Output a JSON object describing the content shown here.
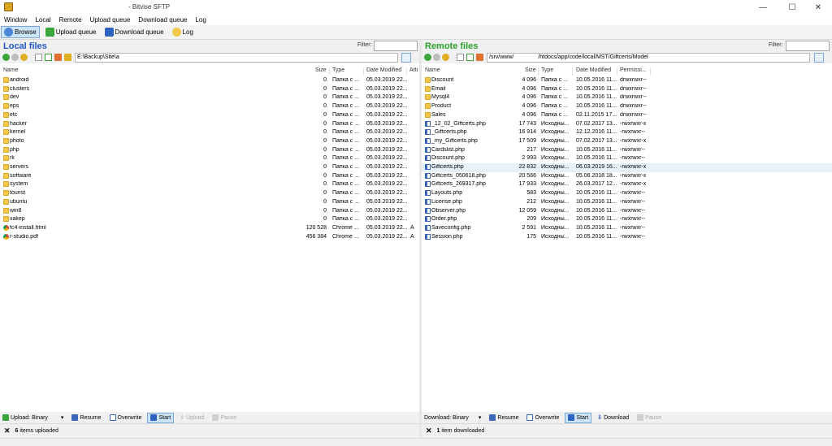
{
  "window": {
    "title": "- Bitvise SFTP",
    "minimize": "—",
    "maximize": "☐",
    "close": "✕"
  },
  "menu": [
    "Window",
    "Local",
    "Remote",
    "Upload queue",
    "Download queue",
    "Log"
  ],
  "toolbar": {
    "browse": "Browse",
    "upload_queue": "Upload queue",
    "download_queue": "Download queue",
    "log": "Log"
  },
  "local": {
    "title": "Local files",
    "filter_label": "Filter:",
    "filter_value": "",
    "path": "E:\\Backup\\Site\\a",
    "columns": {
      "name": "Name",
      "size": "Size",
      "type": "Type",
      "modified": "Date Modified",
      "attr": "Attr"
    },
    "rows": [
      {
        "name": "android",
        "size": "0",
        "type": "Папка с ...",
        "modified": "05.03.2019 22...",
        "attr": "",
        "icon": "folder"
      },
      {
        "name": "clusters",
        "size": "0",
        "type": "Папка с ...",
        "modified": "05.03.2019 22...",
        "attr": "",
        "icon": "folder"
      },
      {
        "name": "dev",
        "size": "0",
        "type": "Папка с ...",
        "modified": "05.03.2019 22...",
        "attr": "",
        "icon": "folder"
      },
      {
        "name": "eps",
        "size": "0",
        "type": "Папка с ...",
        "modified": "05.03.2019 22...",
        "attr": "",
        "icon": "folder"
      },
      {
        "name": "etc",
        "size": "0",
        "type": "Папка с ...",
        "modified": "05.03.2019 22...",
        "attr": "",
        "icon": "folder"
      },
      {
        "name": "hacker",
        "size": "0",
        "type": "Папка с ...",
        "modified": "05.03.2019 22...",
        "attr": "",
        "icon": "folder"
      },
      {
        "name": "kernel",
        "size": "0",
        "type": "Папка с ...",
        "modified": "05.03.2019 22...",
        "attr": "",
        "icon": "folder"
      },
      {
        "name": "photo",
        "size": "0",
        "type": "Папка с ...",
        "modified": "05.03.2019 22...",
        "attr": "",
        "icon": "folder"
      },
      {
        "name": "php",
        "size": "0",
        "type": "Папка с ...",
        "modified": "05.03.2019 22...",
        "attr": "",
        "icon": "folder"
      },
      {
        "name": "rk",
        "size": "0",
        "type": "Папка с ...",
        "modified": "05.03.2019 22...",
        "attr": "",
        "icon": "folder"
      },
      {
        "name": "servers",
        "size": "0",
        "type": "Папка с ...",
        "modified": "05.03.2019 22...",
        "attr": "",
        "icon": "folder"
      },
      {
        "name": "software",
        "size": "0",
        "type": "Папка с ...",
        "modified": "05.03.2019 22...",
        "attr": "",
        "icon": "folder"
      },
      {
        "name": "system",
        "size": "0",
        "type": "Папка с ...",
        "modified": "05.03.2019 22...",
        "attr": "",
        "icon": "folder"
      },
      {
        "name": "tourist",
        "size": "0",
        "type": "Папка с ...",
        "modified": "05.03.2019 22...",
        "attr": "",
        "icon": "folder"
      },
      {
        "name": "ubuntu",
        "size": "0",
        "type": "Папка с ...",
        "modified": "05.03.2019 22...",
        "attr": "",
        "icon": "folder"
      },
      {
        "name": "win8",
        "size": "0",
        "type": "Папка с ...",
        "modified": "05.03.2019 22...",
        "attr": "",
        "icon": "folder"
      },
      {
        "name": "xakep",
        "size": "0",
        "type": "Папка с ...",
        "modified": "05.03.2019 22...",
        "attr": "",
        "icon": "folder"
      },
      {
        "name": "fc4-install.html",
        "size": "120 528",
        "type": "Chrome ...",
        "modified": "05.03.2019 22...",
        "attr": "A",
        "icon": "chrome"
      },
      {
        "name": "r-studio.pdf",
        "size": "456 384",
        "type": "Chrome ...",
        "modified": "05.03.2019 22...",
        "attr": "A",
        "icon": "chrome"
      }
    ],
    "controls": {
      "upload_mode": "Upload: Binary",
      "resume": "Resume",
      "overwrite": "Overwrite",
      "start": "Start",
      "upload": "Upload",
      "pause": "Pause"
    },
    "status": {
      "x": "✕",
      "count": "6",
      "text": "items uploaded"
    }
  },
  "remote": {
    "title": "Remote files",
    "filter_label": "Filter:",
    "filter_value": "",
    "path_prefix": "/srv/www/",
    "path": "/htdocs/app/code/local/MST/Giftcerts/Model",
    "columns": {
      "name": "Name",
      "size": "Size",
      "type": "Type",
      "modified": "Date Modified",
      "perm": "Permissi..."
    },
    "rows": [
      {
        "name": "Discount",
        "size": "4 096",
        "type": "Папка с ...",
        "modified": "10.05.2016 11...",
        "perm": "drwxrwxr--",
        "icon": "folder"
      },
      {
        "name": "Email",
        "size": "4 096",
        "type": "Папка с ...",
        "modified": "10.05.2016 11...",
        "perm": "drwxrwxr--",
        "icon": "folder"
      },
      {
        "name": "Mysql4",
        "size": "4 096",
        "type": "Папка с ...",
        "modified": "10.05.2016 11...",
        "perm": "drwxrwxr--",
        "icon": "folder"
      },
      {
        "name": "Product",
        "size": "4 096",
        "type": "Папка с ...",
        "modified": "10.05.2016 11...",
        "perm": "drwxrwxr--",
        "icon": "folder"
      },
      {
        "name": "Sales",
        "size": "4 096",
        "type": "Папка с ...",
        "modified": "02.11.2015 17...",
        "perm": "drwxrwxr--",
        "icon": "folder"
      },
      {
        "name": "_12_02_Giftcerts.php",
        "size": "17 743",
        "type": "Исходны...",
        "modified": "07.02.2017 13...",
        "perm": "-rwxrwxr-x",
        "icon": "php"
      },
      {
        "name": "_Giftcerts.php",
        "size": "16 914",
        "type": "Исходны...",
        "modified": "12.12.2016 11...",
        "perm": "-rwxrwxr--",
        "icon": "php"
      },
      {
        "name": "_my_Giftcerts.php",
        "size": "17 509",
        "type": "Исходны...",
        "modified": "07.02.2017 13...",
        "perm": "-rwxrwxr-x",
        "icon": "php"
      },
      {
        "name": "Cardslist.php",
        "size": "217",
        "type": "Исходны...",
        "modified": "10.05.2016 11...",
        "perm": "-rwxrwxr--",
        "icon": "php"
      },
      {
        "name": "Discount.php",
        "size": "2 993",
        "type": "Исходны...",
        "modified": "10.05.2016 11...",
        "perm": "-rwxrwxr--",
        "icon": "php"
      },
      {
        "name": "Giftcerts.php",
        "size": "22 832",
        "type": "Исходны...",
        "modified": "06.03.2019 16...",
        "perm": "-rwxrwxr-x",
        "icon": "php",
        "selected": true
      },
      {
        "name": "Giftcerts_050618.php",
        "size": "20 566",
        "type": "Исходны...",
        "modified": "05.06.2018 18...",
        "perm": "-rwxrwxr-x",
        "icon": "php"
      },
      {
        "name": "Giftcerts_269317.php",
        "size": "17 933",
        "type": "Исходны...",
        "modified": "26.03.2017 12...",
        "perm": "-rwxrwxr-x",
        "icon": "php"
      },
      {
        "name": "Layouts.php",
        "size": "583",
        "type": "Исходны...",
        "modified": "10.05.2016 11...",
        "perm": "-rwxrwxr--",
        "icon": "php"
      },
      {
        "name": "License.php",
        "size": "212",
        "type": "Исходны...",
        "modified": "10.05.2016 11...",
        "perm": "-rwxrwxr--",
        "icon": "php"
      },
      {
        "name": "Observer.php",
        "size": "12 059",
        "type": "Исходны...",
        "modified": "10.05.2016 11...",
        "perm": "-rwxrwxr--",
        "icon": "php"
      },
      {
        "name": "Order.php",
        "size": "209",
        "type": "Исходны...",
        "modified": "10.05.2016 11...",
        "perm": "-rwxrwxr--",
        "icon": "php"
      },
      {
        "name": "Saveconfig.php",
        "size": "2 591",
        "type": "Исходны...",
        "modified": "10.05.2016 11...",
        "perm": "-rwxrwxr--",
        "icon": "php"
      },
      {
        "name": "Session.php",
        "size": "175",
        "type": "Исходны...",
        "modified": "10.05.2016 11...",
        "perm": "-rwxrwxr--",
        "icon": "php"
      }
    ],
    "controls": {
      "download_mode": "Download: Binary",
      "resume": "Resume",
      "overwrite": "Overwrite",
      "start": "Start",
      "download": "Download",
      "pause": "Pause"
    },
    "status": {
      "x": "✕",
      "count": "1",
      "text": "item downloaded"
    }
  }
}
